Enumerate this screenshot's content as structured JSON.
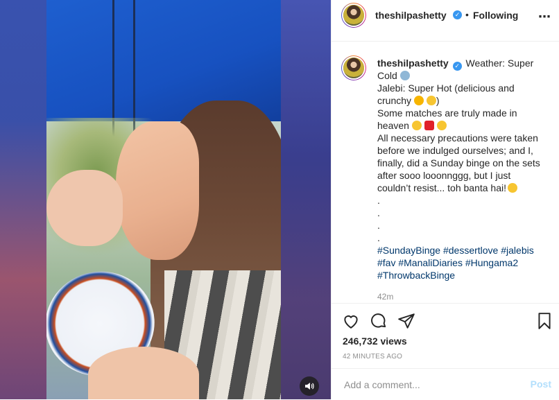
{
  "header": {
    "username": "theshilpashetty",
    "dot": "•",
    "follow_label": "Following",
    "more_icon": "more-options-icon"
  },
  "caption": {
    "username": "theshilpashetty",
    "lines": [
      "Weather: Super",
      "Cold",
      "Jalebi: Super Hot (delicious and",
      "crunchy",
      ")",
      "Some matches are truly made in",
      "heaven",
      "All necessary precautions were taken",
      "before we indulged ourselves; and I,",
      "finally, did a Sunday binge on the sets",
      "after sooo looonnggg, but I just",
      "couldn’t resist... toh banta hai!",
      ".",
      ".",
      ".",
      "."
    ],
    "hashtags_line1": "#SundayBinge #dessertlove #jalebis",
    "hashtags_line2": "#fav #ManaliDiaries #Hungama2",
    "hashtags_line3": "#ThrowbackBinge",
    "time": "42m"
  },
  "actions": {
    "like_icon": "heart-icon",
    "comment_icon": "comment-icon",
    "share_icon": "share-icon",
    "save_icon": "bookmark-icon"
  },
  "stats": {
    "views": "246,732 views",
    "posted_ago": "42 MINUTES AGO"
  },
  "comment": {
    "placeholder": "Add a comment...",
    "post_label": "Post"
  },
  "media": {
    "sound_icon": "speaker-icon"
  },
  "colors": {
    "link": "#00376b",
    "verified": "#3897f0",
    "post_disabled": "#b2dffc"
  }
}
